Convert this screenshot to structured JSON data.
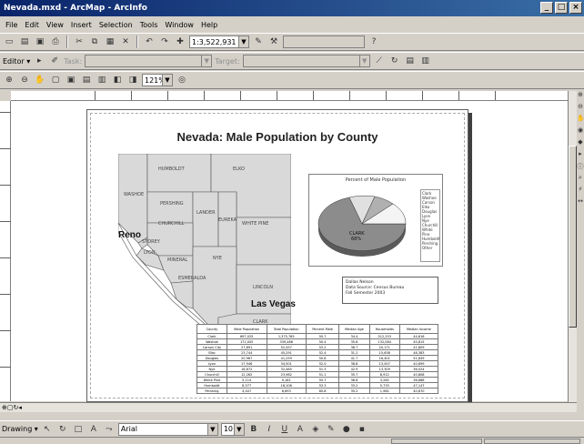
{
  "window": {
    "title": "Nevada.mxd - ArcMap - ArcInfo"
  },
  "menu": [
    "File",
    "Edit",
    "View",
    "Insert",
    "Selection",
    "Tools",
    "Window",
    "Help"
  ],
  "toolbar": {
    "scale": "1:3,522,931",
    "editor_label": "Editor ▾",
    "task_label": "Task:",
    "target_label": "Target:",
    "zoom": "121%"
  },
  "layout": {
    "title": "Nevada: Male Population by County",
    "counties": [
      {
        "id": "humboldt",
        "name": "HUMBOLDT"
      },
      {
        "id": "elko",
        "name": "ELKO"
      },
      {
        "id": "pershing",
        "name": "PERSHING"
      },
      {
        "id": "washoe",
        "name": "WASHOE"
      },
      {
        "id": "lander",
        "name": "LANDER"
      },
      {
        "id": "eureka",
        "name": "EUREKA"
      },
      {
        "id": "churchill",
        "name": "CHURCHILL"
      },
      {
        "id": "white-pine",
        "name": "WHITE PINE"
      },
      {
        "id": "storey",
        "name": "STOREY"
      },
      {
        "id": "lyon",
        "name": "LYON"
      },
      {
        "id": "mineral",
        "name": "MINERAL"
      },
      {
        "id": "nye",
        "name": "NYE"
      },
      {
        "id": "esmeralda",
        "name": "ESMERALDA"
      },
      {
        "id": "lincoln",
        "name": "LINCOLN"
      },
      {
        "id": "clark",
        "name": "CLARK"
      }
    ],
    "cities": {
      "reno": "Reno",
      "las_vegas": "Las Vegas"
    },
    "pie": {
      "title": "Percent of Male Population",
      "center_label": "CLARK",
      "center_value": "68%"
    },
    "credits": [
      "Dallas Nelson",
      "Data Source: Census Bureau",
      "Fall Semester 2003"
    ],
    "table": {
      "headers": [
        "County",
        "Male Population",
        "Total Population",
        "Percent Male",
        "Median Age",
        "Households",
        "Median Income"
      ],
      "rows": [
        [
          "Clark",
          "697,025",
          "1,375,765",
          "50.7",
          "34.4",
          "512,253",
          "44,616"
        ],
        [
          "Washoe",
          "171,005",
          "339,486",
          "50.4",
          "35.6",
          "132,084",
          "45,815"
        ],
        [
          "Carson City",
          "27,891",
          "52,457",
          "53.2",
          "38.7",
          "20,171",
          "41,809"
        ],
        [
          "Elko",
          "23,744",
          "45,291",
          "52.4",
          "31.2",
          "15,638",
          "48,383"
        ],
        [
          "Douglas",
          "20,967",
          "41,259",
          "50.8",
          "41.7",
          "16,401",
          "51,849"
        ],
        [
          "Lyon",
          "17,946",
          "34,501",
          "52.0",
          "38.8",
          "13,007",
          "40,699"
        ],
        [
          "Nye",
          "16,672",
          "32,485",
          "51.3",
          "42.9",
          "13,309",
          "36,024"
        ],
        [
          "Churchill",
          "12,262",
          "23,982",
          "51.1",
          "35.7",
          "8,912",
          "40,808"
        ],
        [
          "White Pine",
          "5,114",
          "9,181",
          "55.7",
          "38.6",
          "3,282",
          "36,688"
        ],
        [
          "Humboldt",
          "8,577",
          "16,106",
          "53.3",
          "33.2",
          "5,733",
          "47,147"
        ],
        [
          "Pershing",
          "4,407",
          "6,693",
          "65.8",
          "35.2",
          "1,962",
          "40,670"
        ]
      ]
    },
    "legend": [
      "Clark",
      "Washoe",
      "Carson",
      "Elko",
      "Douglas",
      "Lyon",
      "Nye",
      "Churchill",
      "White Pine",
      "Humboldt",
      "Pershing",
      "Other"
    ]
  },
  "status": {
    "drawing_label": "Drawing ▾",
    "font_name": "Arial",
    "font_size": "10",
    "bold": "B",
    "italic": "I",
    "underline": "U"
  },
  "colors": {
    "title_bar": "#0a246a",
    "face": "#d4d0c8",
    "county_fill": "#d9d9d9",
    "pie_main": "#8c8c8c"
  }
}
